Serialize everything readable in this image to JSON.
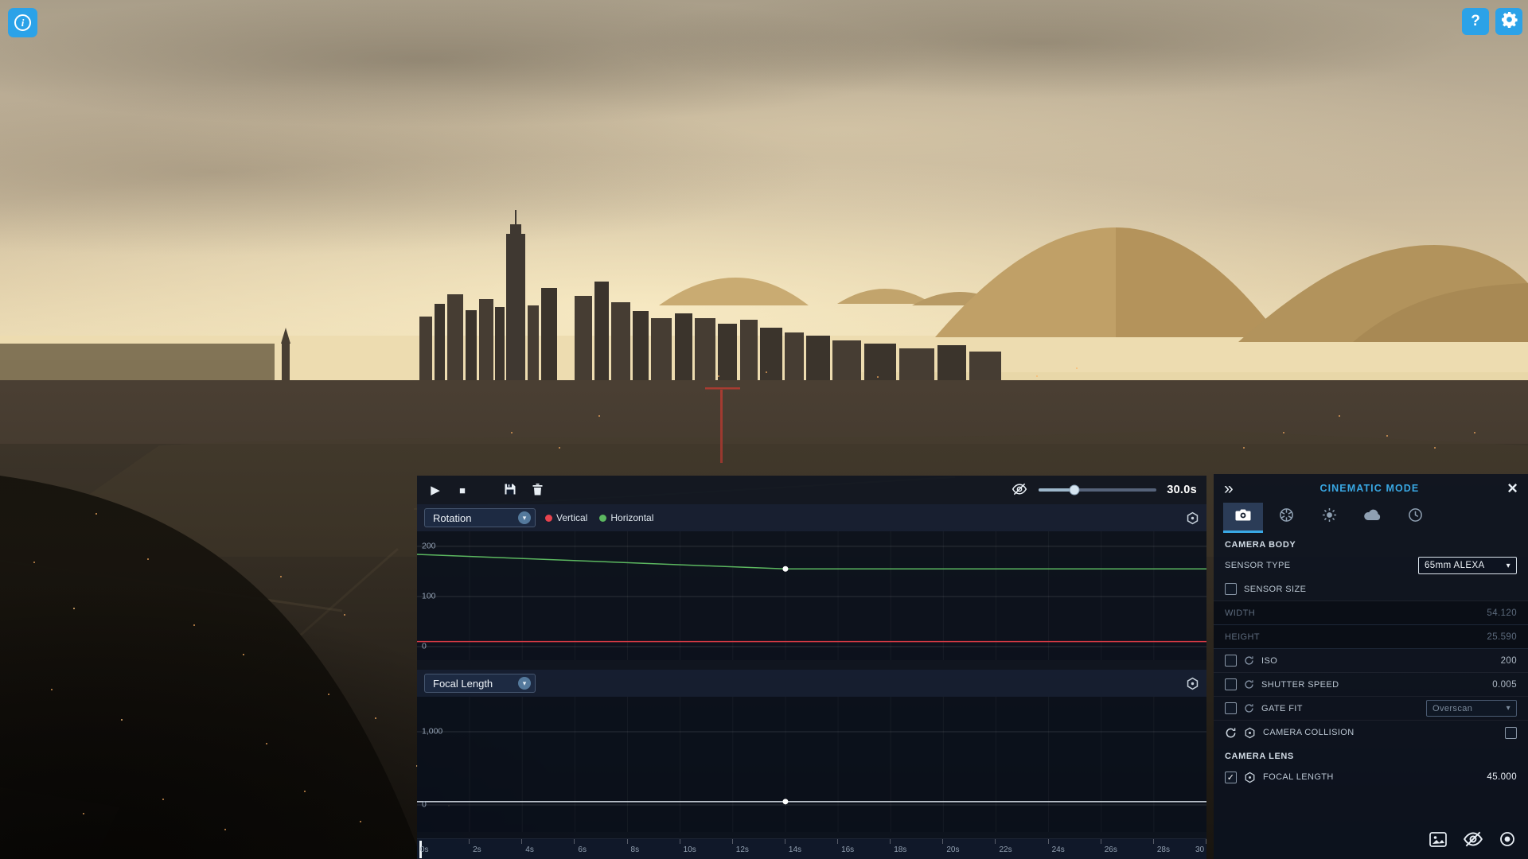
{
  "icons": {
    "info": "i",
    "help": "?",
    "close": "×",
    "collapse": "»",
    "chevron_down": "▾",
    "play": "▶",
    "stop": "■",
    "check": "✓"
  },
  "toolbar": {
    "duration_label": "30.0s",
    "slider_percent": 30
  },
  "timeline": {
    "time_ticks": [
      "0s",
      "2s",
      "4s",
      "6s",
      "8s",
      "10s",
      "12s",
      "14s",
      "16s",
      "18s",
      "20s",
      "22s",
      "24s",
      "26s",
      "28s",
      "30"
    ],
    "tracks": [
      {
        "name": "Rotation",
        "y_ticks": [
          "200",
          "100",
          "0"
        ],
        "value_range": [
          -27,
          230
        ],
        "legend": [
          {
            "label": "Vertical",
            "color": "#e8434e"
          },
          {
            "label": "Horizontal",
            "color": "#5cb860"
          }
        ],
        "curves": [
          {
            "name": "Horizontal",
            "color": "#5cb860",
            "t": [
              0,
              14,
              30
            ],
            "v": [
              184,
              155,
              155
            ],
            "keyframes": [
              14
            ]
          },
          {
            "name": "Vertical",
            "color": "#d63a44",
            "t": [
              0,
              30
            ],
            "v": [
              10,
              10
            ],
            "keyframes": []
          }
        ]
      },
      {
        "name": "Focal Length",
        "y_ticks": [
          "1,000",
          "0"
        ],
        "value_range": [
          -370,
          1478
        ],
        "legend": [],
        "curves": [
          {
            "name": "Focal Length",
            "color": "#d7dee6",
            "t": [
              0,
              14,
              30
            ],
            "v": [
              45,
              45,
              45
            ],
            "keyframes": [
              14
            ]
          }
        ]
      }
    ]
  },
  "camera_panel": {
    "title": "CINEMATIC MODE",
    "sections": {
      "body_label": "CAMERA BODY",
      "lens_label": "CAMERA LENS"
    },
    "rows": {
      "sensor_type_label": "SENSOR TYPE",
      "sensor_type_value": "65mm ALEXA",
      "sensor_size_label": "SENSOR SIZE",
      "width_label": "WIDTH",
      "width_value": "54.120",
      "height_label": "HEIGHT",
      "height_value": "25.590",
      "iso_label": "ISO",
      "iso_value": "200",
      "shutter_label": "SHUTTER SPEED",
      "shutter_value": "0.005",
      "gate_fit_label": "GATE FIT",
      "gate_fit_value": "Overscan",
      "collision_label": "CAMERA COLLISION",
      "focal_label": "FOCAL LENGTH",
      "focal_value": "45.000"
    }
  }
}
